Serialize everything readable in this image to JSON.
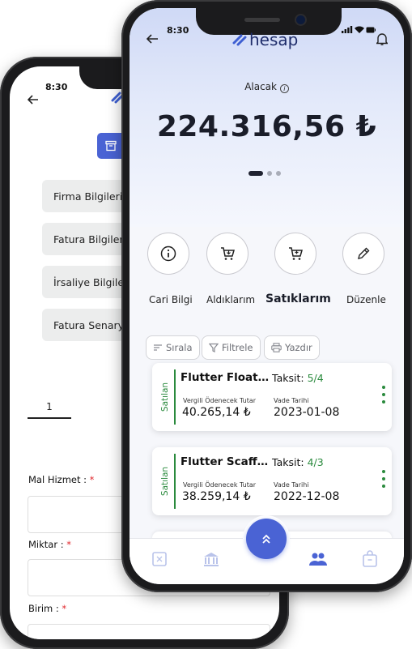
{
  "back_phone": {
    "status_time": "8:30",
    "menu": [
      {
        "label": "Firma Bilgileri"
      },
      {
        "label": "Fatura Bilgileri"
      },
      {
        "label": "İrsaliye Bilgileri"
      },
      {
        "label": "Fatura Senaryosu"
      }
    ],
    "step_number": "1",
    "fields": [
      {
        "label": "Mal Hizmet :",
        "required": "*"
      },
      {
        "label": "Miktar :",
        "required": "*"
      },
      {
        "label": "Birim :",
        "required": "*"
      }
    ]
  },
  "front_phone": {
    "status_time": "8:30",
    "logo_text": "hesap",
    "balance_label": "Alacak",
    "info_icon": "info-icon",
    "balance_amount": "224.316,56 ₺",
    "carousel": {
      "pages": 3,
      "active": 1
    },
    "actions": [
      {
        "label": "Cari Bilgi",
        "icon": "info-icon"
      },
      {
        "label": "Aldıklarım",
        "icon": "cart-icon"
      },
      {
        "label": "Satıklarım",
        "icon": "cart-plus-icon",
        "active": true
      },
      {
        "label": "Düzenle",
        "icon": "pencil-icon"
      }
    ],
    "filters": [
      {
        "label": "Sırala",
        "icon": "sort-icon"
      },
      {
        "label": "Filtrele",
        "icon": "filter-icon"
      },
      {
        "label": "Yazdır",
        "icon": "printer-icon"
      }
    ],
    "transactions": [
      {
        "status": "Satılan",
        "title": "Flutter Floating Action Button",
        "taksit_label": "Taksit:",
        "taksit_value": "5/4",
        "tax_label": "Vergili Ödenecek Tutar",
        "tax_value": "40.265,14 ₺",
        "due_label": "Vade Tarihi",
        "due_value": "2023-01-08"
      },
      {
        "status": "Satılan",
        "title": "Flutter Scaffold",
        "taksit_label": "Taksit:",
        "taksit_value": "4/3",
        "tax_label": "Vergili Ödenecek Tutar",
        "tax_value": "38.259,14 ₺",
        "due_label": "Vade Tarihi",
        "due_value": "2022-12-08"
      }
    ],
    "colors": {
      "accent": "#4a63d4",
      "green": "#2a8a3d",
      "nav_icon": "#b9c3ea"
    }
  }
}
